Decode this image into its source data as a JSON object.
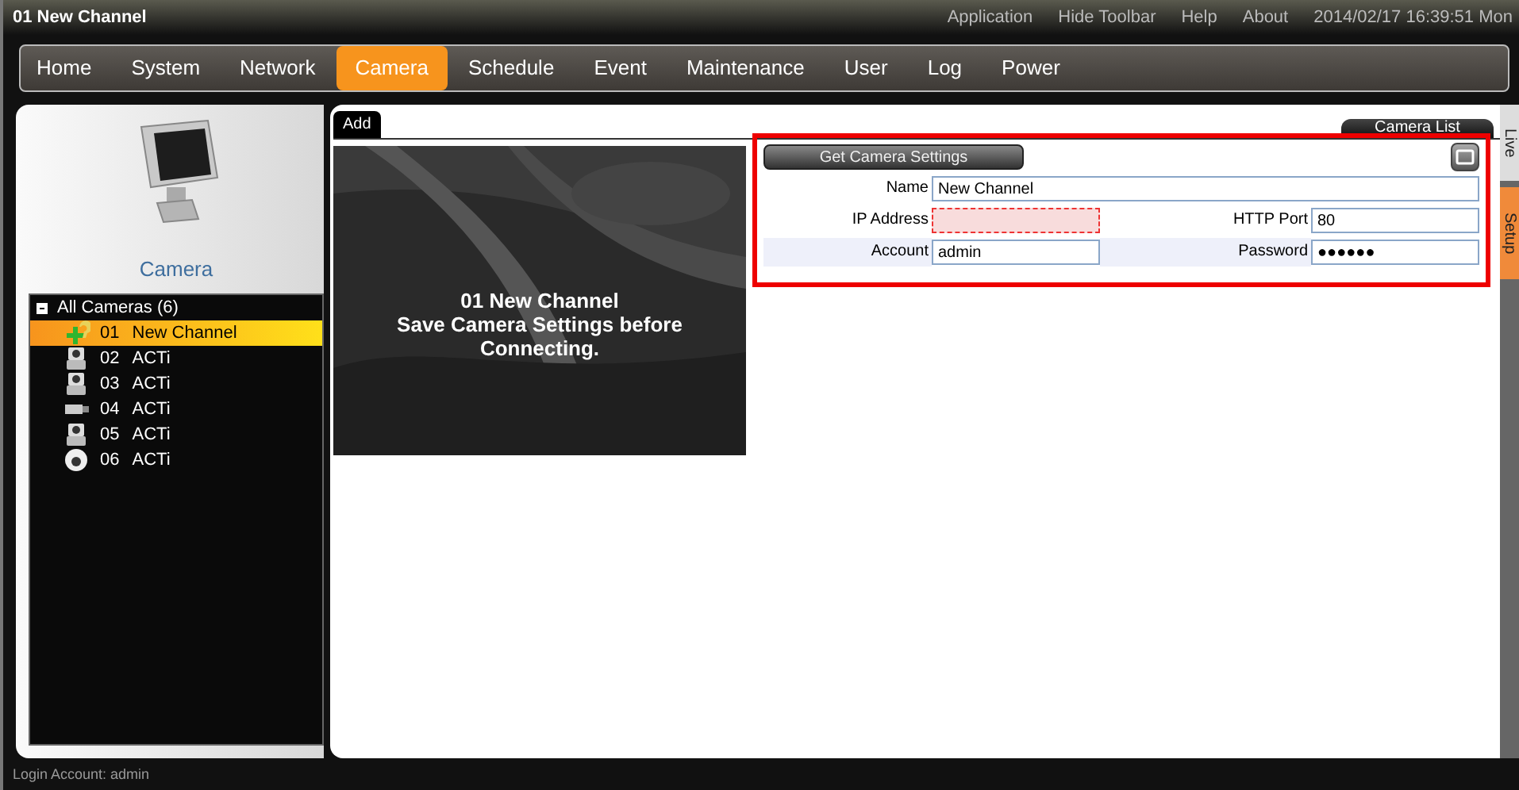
{
  "window": {
    "title": "01 New Channel"
  },
  "top_links": [
    "Application",
    "Hide Toolbar",
    "Help",
    "About"
  ],
  "clock": "2014/02/17 16:39:51 Mon",
  "menu": [
    {
      "label": "Home",
      "selected": false
    },
    {
      "label": "System",
      "selected": false
    },
    {
      "label": "Network",
      "selected": false
    },
    {
      "label": "Camera",
      "selected": true
    },
    {
      "label": "Schedule",
      "selected": false
    },
    {
      "label": "Event",
      "selected": false
    },
    {
      "label": "Maintenance",
      "selected": false
    },
    {
      "label": "User",
      "selected": false
    },
    {
      "label": "Log",
      "selected": false
    },
    {
      "label": "Power",
      "selected": false
    }
  ],
  "sidebar": {
    "title": "Camera",
    "tree": {
      "label": "All Cameras (6)",
      "expanded": true,
      "children": [
        {
          "number": "01",
          "name": "New Channel",
          "kind": "new",
          "selected": true
        },
        {
          "number": "02",
          "name": "ACTi",
          "kind": "ptz",
          "selected": false
        },
        {
          "number": "03",
          "name": "ACTi",
          "kind": "ptz",
          "selected": false
        },
        {
          "number": "04",
          "name": "ACTi",
          "kind": "box",
          "selected": false
        },
        {
          "number": "05",
          "name": "ACTi",
          "kind": "ptz",
          "selected": false
        },
        {
          "number": "06",
          "name": "ACTi",
          "kind": "dome",
          "selected": false
        }
      ]
    }
  },
  "tab": {
    "label": "Add",
    "selected": true
  },
  "camera_list_button": "Camera List",
  "preview": {
    "lines": [
      "01 New Channel",
      "Save Camera Settings before Connecting."
    ]
  },
  "settings": {
    "button": "Get Camera Settings",
    "fields": [
      {
        "label": "Name",
        "value": "New Channel",
        "invalid": false,
        "wide": true
      },
      {
        "label": "IP Address",
        "invalid": true,
        "wide": false
      },
      {
        "label": "HTTP Port",
        "value": "80",
        "invalid": false,
        "wide": false
      },
      {
        "label": "Account",
        "value": "admin",
        "invalid": false,
        "wide": false
      },
      {
        "label": "Password",
        "value": "●●●●●●",
        "invalid": false,
        "wide": false
      }
    ]
  },
  "side_tabs": [
    {
      "label": "Live",
      "selected": false
    },
    {
      "label": "Setup",
      "selected": true
    }
  ],
  "status_bar": "Login Account: admin"
}
